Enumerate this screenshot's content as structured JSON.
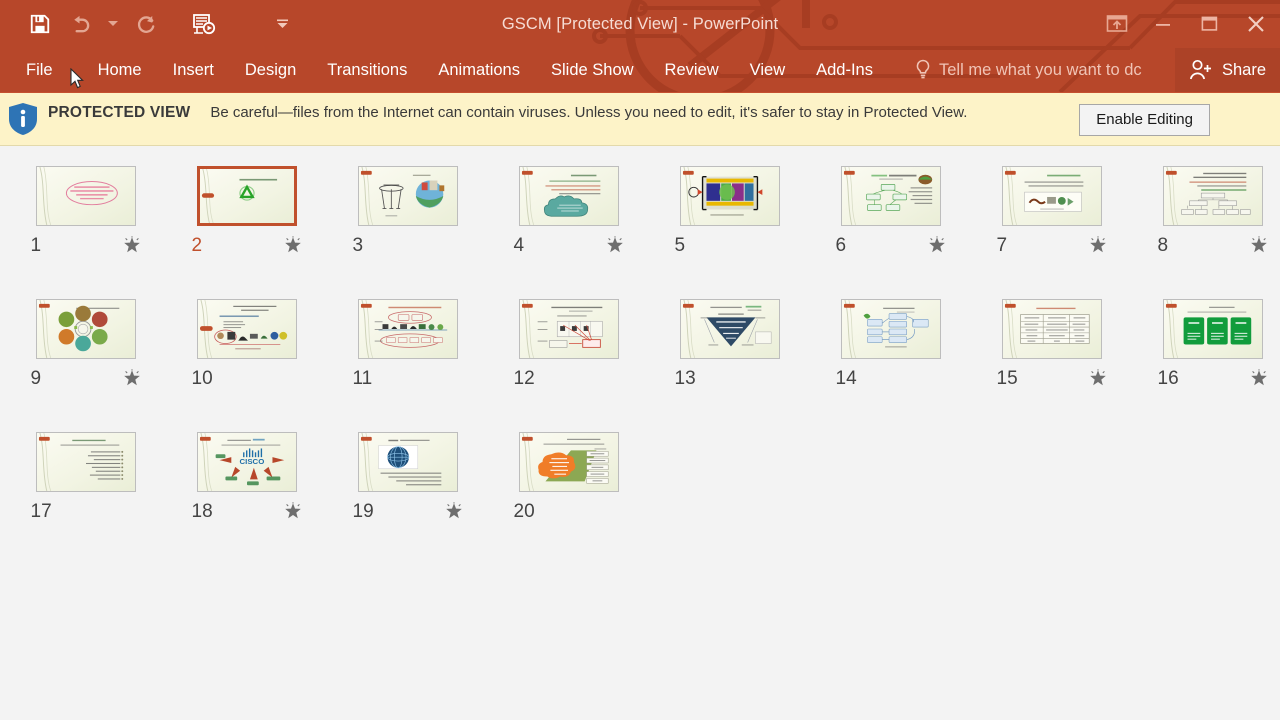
{
  "window": {
    "title": "GSCM [Protected View] - PowerPoint",
    "accent_color": "#b7472a",
    "controls": {
      "ribbon_display_options": "Ribbon Display Options",
      "minimize": "Minimize",
      "restore": "Restore Down",
      "close": "Close"
    }
  },
  "quick_access": {
    "items": [
      {
        "name": "save",
        "label": "Save",
        "enabled": true
      },
      {
        "name": "undo",
        "label": "Undo",
        "enabled": false
      },
      {
        "name": "undo-dropdown",
        "label": "Undo options",
        "enabled": false
      },
      {
        "name": "redo",
        "label": "Repeat",
        "enabled": false
      },
      {
        "name": "start-from-beginning",
        "label": "Start From Beginning",
        "enabled": true
      },
      {
        "name": "customize",
        "label": "Customize Quick Access Toolbar",
        "enabled": true
      }
    ]
  },
  "ribbon": {
    "tabs": [
      {
        "label": "File"
      },
      {
        "label": "Home"
      },
      {
        "label": "Insert"
      },
      {
        "label": "Design"
      },
      {
        "label": "Transitions"
      },
      {
        "label": "Animations"
      },
      {
        "label": "Slide Show"
      },
      {
        "label": "Review"
      },
      {
        "label": "View"
      },
      {
        "label": "Add-Ins"
      }
    ],
    "tell_me_placeholder": "Tell me what you want to dc",
    "share_label": "Share"
  },
  "protected_view": {
    "label": "PROTECTED VIEW",
    "message": "Be careful—files from the Internet can contain viruses. Unless you need to edit, it's safer to stay in Protected View.",
    "enable_button": "Enable Editing",
    "background_color": "#fdf3c8"
  },
  "slide_sorter": {
    "selected_slide": 2,
    "slides": [
      {
        "number": "1",
        "has_animation": true,
        "selected": false,
        "art": "bismillah"
      },
      {
        "number": "2",
        "has_animation": true,
        "selected": true,
        "art": "title-recycle"
      },
      {
        "number": "3",
        "has_animation": false,
        "selected": false,
        "art": "stool-globe"
      },
      {
        "number": "4",
        "has_animation": true,
        "selected": false,
        "art": "text-cloud"
      },
      {
        "number": "5",
        "has_animation": false,
        "selected": false,
        "art": "supply-diagram"
      },
      {
        "number": "6",
        "has_animation": true,
        "selected": false,
        "art": "green-scm-map"
      },
      {
        "number": "7",
        "has_animation": true,
        "selected": false,
        "art": "text-chain"
      },
      {
        "number": "8",
        "has_animation": true,
        "selected": false,
        "art": "org-tree"
      },
      {
        "number": "9",
        "has_animation": true,
        "selected": false,
        "art": "circle-wheel"
      },
      {
        "number": "10",
        "has_animation": false,
        "selected": false,
        "art": "lifecycle-icons"
      },
      {
        "number": "11",
        "has_animation": false,
        "selected": false,
        "art": "flow-icons"
      },
      {
        "number": "12",
        "has_animation": false,
        "selected": false,
        "art": "matrix-arrows"
      },
      {
        "number": "13",
        "has_animation": false,
        "selected": false,
        "art": "funnel"
      },
      {
        "number": "14",
        "has_animation": false,
        "selected": false,
        "art": "blue-flow"
      },
      {
        "number": "15",
        "has_animation": true,
        "selected": false,
        "art": "table"
      },
      {
        "number": "16",
        "has_animation": true,
        "selected": false,
        "art": "green-cards"
      },
      {
        "number": "17",
        "has_animation": false,
        "selected": false,
        "art": "bullets"
      },
      {
        "number": "18",
        "has_animation": true,
        "selected": false,
        "art": "cisco"
      },
      {
        "number": "19",
        "has_animation": true,
        "selected": false,
        "art": "globe-photo"
      },
      {
        "number": "20",
        "has_animation": false,
        "selected": false,
        "art": "orange-cloud"
      }
    ]
  }
}
